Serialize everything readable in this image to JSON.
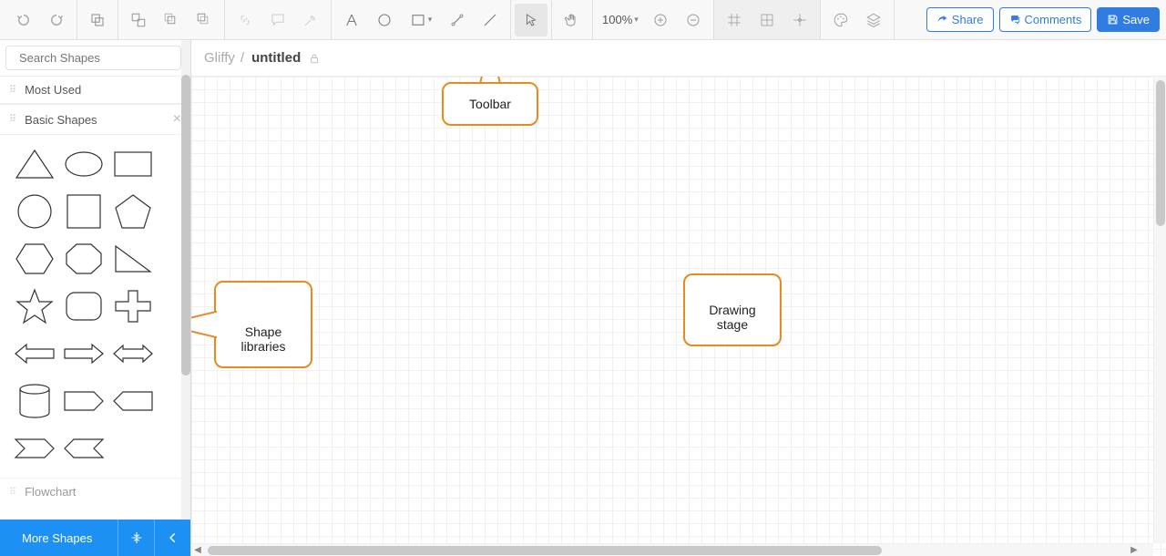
{
  "toolbar": {
    "zoom": "100%"
  },
  "actions": {
    "share": "Share",
    "comments": "Comments",
    "save": "Save"
  },
  "search": {
    "placeholder": "Search Shapes"
  },
  "libraries": {
    "most_used": "Most Used",
    "basic_shapes": "Basic Shapes",
    "flowchart": "Flowchart"
  },
  "footer": {
    "more_shapes": "More Shapes"
  },
  "document": {
    "brand": "Gliffy",
    "separator": "/",
    "title": "untitled"
  },
  "callouts": {
    "toolbar": "Toolbar",
    "shape_libraries": "Shape\nlibraries",
    "drawing_stage": "Drawing\nstage"
  }
}
